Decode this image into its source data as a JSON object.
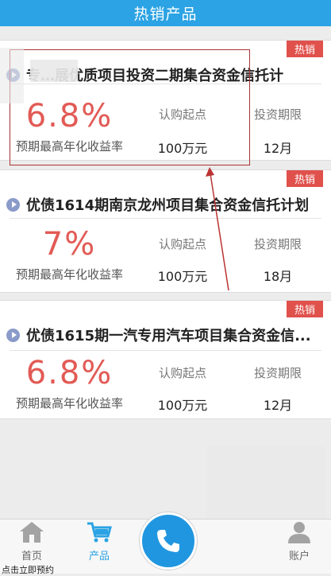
{
  "header": {
    "title": "热销产品"
  },
  "products": [
    {
      "badge": "热销",
      "title": "专…展优质项目投资二期集合资金信托计",
      "rate": "6.8%",
      "rate_label": "预期最高年化收益率",
      "min_label": "认购起点",
      "min_value": "100万元",
      "term_label": "投资期限",
      "term_value": "12月"
    },
    {
      "badge": "热销",
      "title": "优债1614期南京龙州项目集合资金信托计划",
      "rate": "7%",
      "rate_label": "预期最高年化收益率",
      "min_label": "认购起点",
      "min_value": "100万元",
      "term_label": "投资期限",
      "term_value": "18月"
    },
    {
      "badge": "热销",
      "title": "优债1615期一汽专用汽车项目集合资金信...",
      "rate": "6.8%",
      "rate_label": "预期最高年化收益率",
      "min_label": "认购起点",
      "min_value": "100万元",
      "term_label": "投资期限",
      "term_value": "12月"
    }
  ],
  "tabbar": {
    "home": "首页",
    "products": "产品",
    "account": "账户"
  },
  "footnote": "点击立即预约",
  "colors": {
    "brand": "#2ba3e4",
    "accent": "#e25a55",
    "hot": "#e0514c"
  }
}
